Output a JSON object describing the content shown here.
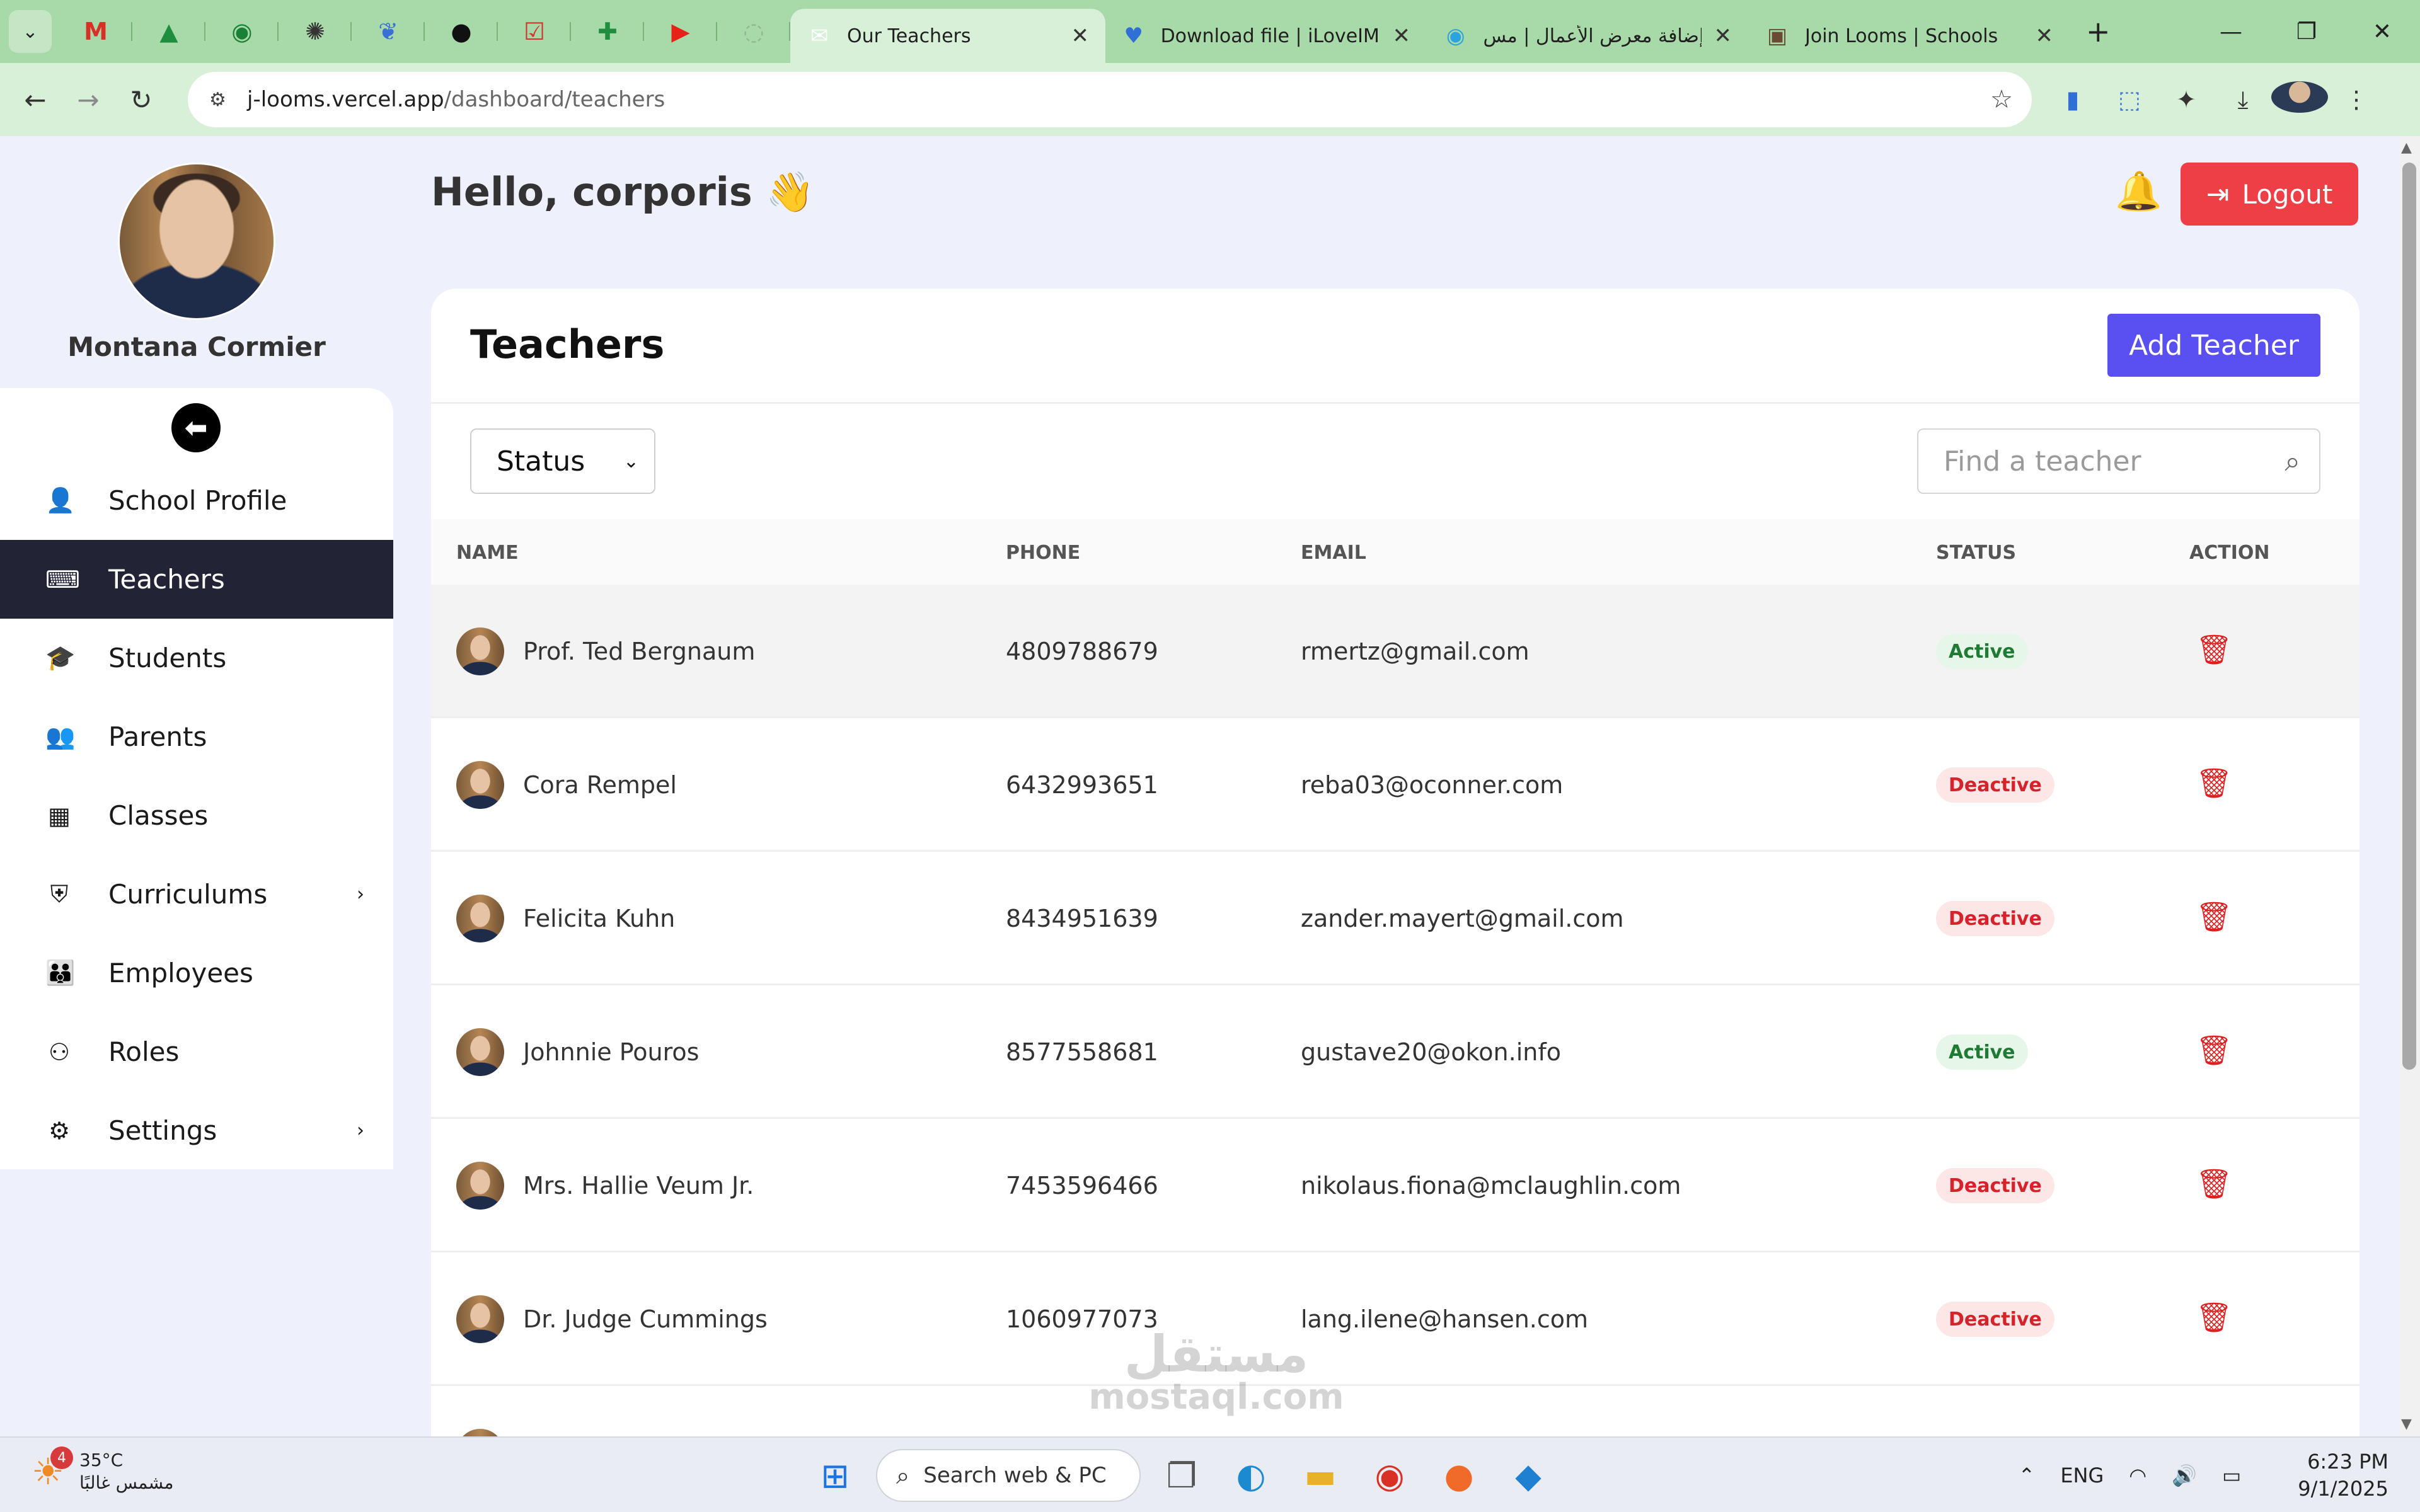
{
  "browser": {
    "tabs": [
      {
        "title": "Our Teachers",
        "active": true,
        "icon": "envelope-icon"
      },
      {
        "title": "Download file | iLoveIMG",
        "active": false,
        "icon": "heart-icon"
      },
      {
        "title": "إضافة معرض الأعمال | مس",
        "active": false,
        "icon": "circle-icon"
      },
      {
        "title": "Join Looms | Schools",
        "active": false,
        "icon": "avatar-icon"
      }
    ],
    "url_host": "j-looms.vercel.app",
    "url_path": "/dashboard/teachers"
  },
  "sidebar": {
    "profile_name": "Montana Cormier",
    "items": [
      {
        "label": "School Profile",
        "icon": "user-icon",
        "active": false,
        "submenu": false
      },
      {
        "label": "Teachers",
        "icon": "chalkboard-teacher-icon",
        "active": true,
        "submenu": false
      },
      {
        "label": "Students",
        "icon": "graduate-icon",
        "active": false,
        "submenu": false
      },
      {
        "label": "Parents",
        "icon": "user-friends-icon",
        "active": false,
        "submenu": false
      },
      {
        "label": "Classes",
        "icon": "classroom-icon",
        "active": false,
        "submenu": false
      },
      {
        "label": "Curriculums",
        "icon": "shield-icon",
        "active": false,
        "submenu": true
      },
      {
        "label": "Employees",
        "icon": "users-icon",
        "active": false,
        "submenu": false
      },
      {
        "label": "Roles",
        "icon": "user-cog-icon",
        "active": false,
        "submenu": false
      },
      {
        "label": "Settings",
        "icon": "gear-icon",
        "active": false,
        "submenu": true
      }
    ]
  },
  "header": {
    "greeting": "Hello, corporis 👋",
    "logout_label": "Logout"
  },
  "main": {
    "title": "Teachers",
    "add_button": "Add Teacher",
    "status_filter": "Status",
    "search_placeholder": "Find a teacher",
    "columns": [
      "NAME",
      "PHONE",
      "EMAIL",
      "STATUS",
      "ACTION"
    ],
    "rows": [
      {
        "name": "Prof. Ted Bergnaum",
        "phone": "4809788679",
        "email": "rmertz@gmail.com",
        "status": "Active"
      },
      {
        "name": "Cora Rempel",
        "phone": "6432993651",
        "email": "reba03@oconner.com",
        "status": "Deactive"
      },
      {
        "name": "Felicita Kuhn",
        "phone": "8434951639",
        "email": "zander.mayert@gmail.com",
        "status": "Deactive"
      },
      {
        "name": "Johnnie Pouros",
        "phone": "8577558681",
        "email": "gustave20@okon.info",
        "status": "Active"
      },
      {
        "name": "Mrs. Hallie Veum Jr.",
        "phone": "7453596466",
        "email": "nikolaus.fiona@mclaughlin.com",
        "status": "Deactive"
      },
      {
        "name": "Dr. Judge Cummings",
        "phone": "1060977073",
        "email": "lang.ilene@hansen.com",
        "status": "Deactive"
      }
    ]
  },
  "watermark": {
    "text": "مستقل",
    "sub": "mostaql.com"
  },
  "taskbar": {
    "weather_temp": "35°C",
    "weather_desc": "مشمس غالبًا",
    "weather_badge": "4",
    "search_label": "Search web & PC",
    "lang": "ENG",
    "time": "6:23 PM",
    "date": "9/1/2025"
  },
  "colors": {
    "accent": "#5a4ff0",
    "logout": "#ee3f46",
    "sidebar_active": "#222436",
    "active_badge": "#1f7a34",
    "deactive_badge": "#d5222b",
    "page_bg": "#eef0fb"
  }
}
